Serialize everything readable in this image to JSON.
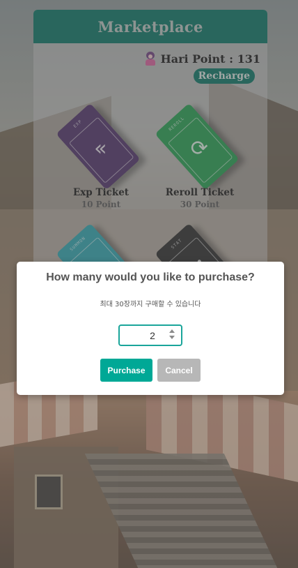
{
  "marketplace": {
    "title": "Marketplace",
    "point_label": "Hari Point : 131",
    "recharge_label": "Recharge",
    "tickets": [
      {
        "name": "Exp Ticket",
        "price": "10 Point",
        "tag": "EXP",
        "color": "#4a2a64",
        "icon": "double-chevron-icon"
      },
      {
        "name": "Reroll Ticket",
        "price": "30 Point",
        "tag": "REROLL",
        "color": "#1d9c4a",
        "icon": "refresh-icon"
      },
      {
        "name": "",
        "price": "",
        "tag": "SUMMON",
        "color": "#27a3ad",
        "icon": "box-icon"
      },
      {
        "name": "",
        "price": "",
        "tag": "STAT",
        "color": "#262626",
        "icon": "sparkle-icon"
      }
    ]
  },
  "modal": {
    "title": "How many would you like to purchase?",
    "text": "최대 30장까지 구매할 수 있습니다",
    "quantity": "2",
    "purchase_label": "Purchase",
    "cancel_label": "Cancel"
  },
  "colors": {
    "brand": "#00705f",
    "accent": "#00a896",
    "cancel": "#b7b7b7"
  }
}
